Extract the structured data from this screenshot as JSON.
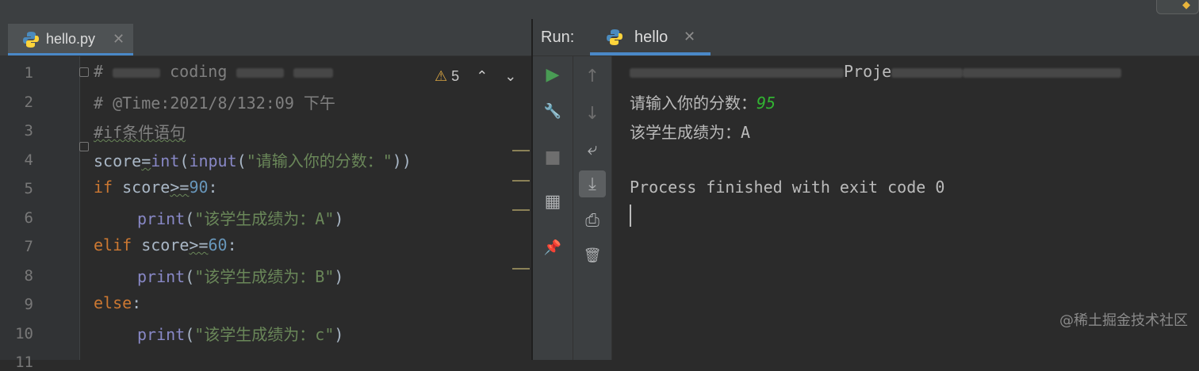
{
  "editor": {
    "tab": {
      "filename": "hello.py",
      "close_glyph": "✕",
      "icon": "python-icon"
    },
    "inspection": {
      "warning_icon": "warning-icon",
      "warning_count": "5",
      "up": "⌃",
      "down": "⌄"
    },
    "line_numbers": [
      "1",
      "2",
      "3",
      "4",
      "5",
      "6",
      "7",
      "8",
      "9",
      "10",
      "11"
    ],
    "lines": {
      "l1": {
        "a": "#",
        "b": "coding"
      },
      "l2": "# @Time:2021/8/132:09 下午",
      "l3": "#if条件语句",
      "l4": {
        "var": "score",
        "eq": "=",
        "int": "int",
        "p1": "(",
        "input": "input",
        "p2": "(",
        "str": "\"请输入你的分数：\"",
        "p3": "))"
      },
      "l5": {
        "kw": "if",
        "sp": " score",
        "op": ">=",
        "num": "90",
        "colon": ":"
      },
      "l6": {
        "fn": "print",
        "p1": "(",
        "str": "\"该学生成绩为：A\"",
        "p2": ")"
      },
      "l7": {
        "kw": "elif",
        "sp": " score",
        "op": ">=",
        "num": "60",
        "colon": ":"
      },
      "l8": {
        "fn": "print",
        "p1": "(",
        "str": "\"该学生成绩为：B\"",
        "p2": ")"
      },
      "l9": {
        "kw": "else",
        "colon": ":"
      },
      "l10": {
        "fn": "print",
        "p1": "(",
        "str": "\"该学生成绩为：c\"",
        "p2": ")"
      }
    }
  },
  "run": {
    "label": "Run:",
    "tab": {
      "name": "hello",
      "close_glyph": "✕",
      "icon": "python-icon"
    },
    "toolbar1": [
      {
        "name": "rerun-icon",
        "glyph": "▶",
        "color": "#499c54"
      },
      {
        "name": "wrench-icon",
        "glyph": "🔧"
      },
      {
        "name": "stop-icon",
        "glyph": "■"
      },
      {
        "name": "layout-icon",
        "glyph": "▦"
      },
      {
        "name": "pin-icon",
        "glyph": "📌"
      }
    ],
    "toolbar2": [
      {
        "name": "up-arrow-icon",
        "glyph": "↑"
      },
      {
        "name": "down-arrow-icon",
        "glyph": "↓"
      },
      {
        "name": "soft-wrap-icon",
        "glyph": "⤶"
      },
      {
        "name": "scroll-to-end-icon",
        "glyph": "⤓"
      },
      {
        "name": "print-icon",
        "glyph": "⎙"
      },
      {
        "name": "trash-icon",
        "glyph": "🗑"
      }
    ],
    "console": {
      "line1_fragment": "Proje",
      "line2_prompt": "请输入你的分数：",
      "line2_input": "95",
      "line3": "该学生成绩为：A",
      "line5": "Process finished with exit code 0"
    }
  },
  "watermark": "@稀土掘金技术社区",
  "colors": {
    "accent": "#4a88c7",
    "keyword": "#cc7832",
    "string": "#6a8759",
    "number": "#6897bb",
    "input": "#32b432"
  }
}
